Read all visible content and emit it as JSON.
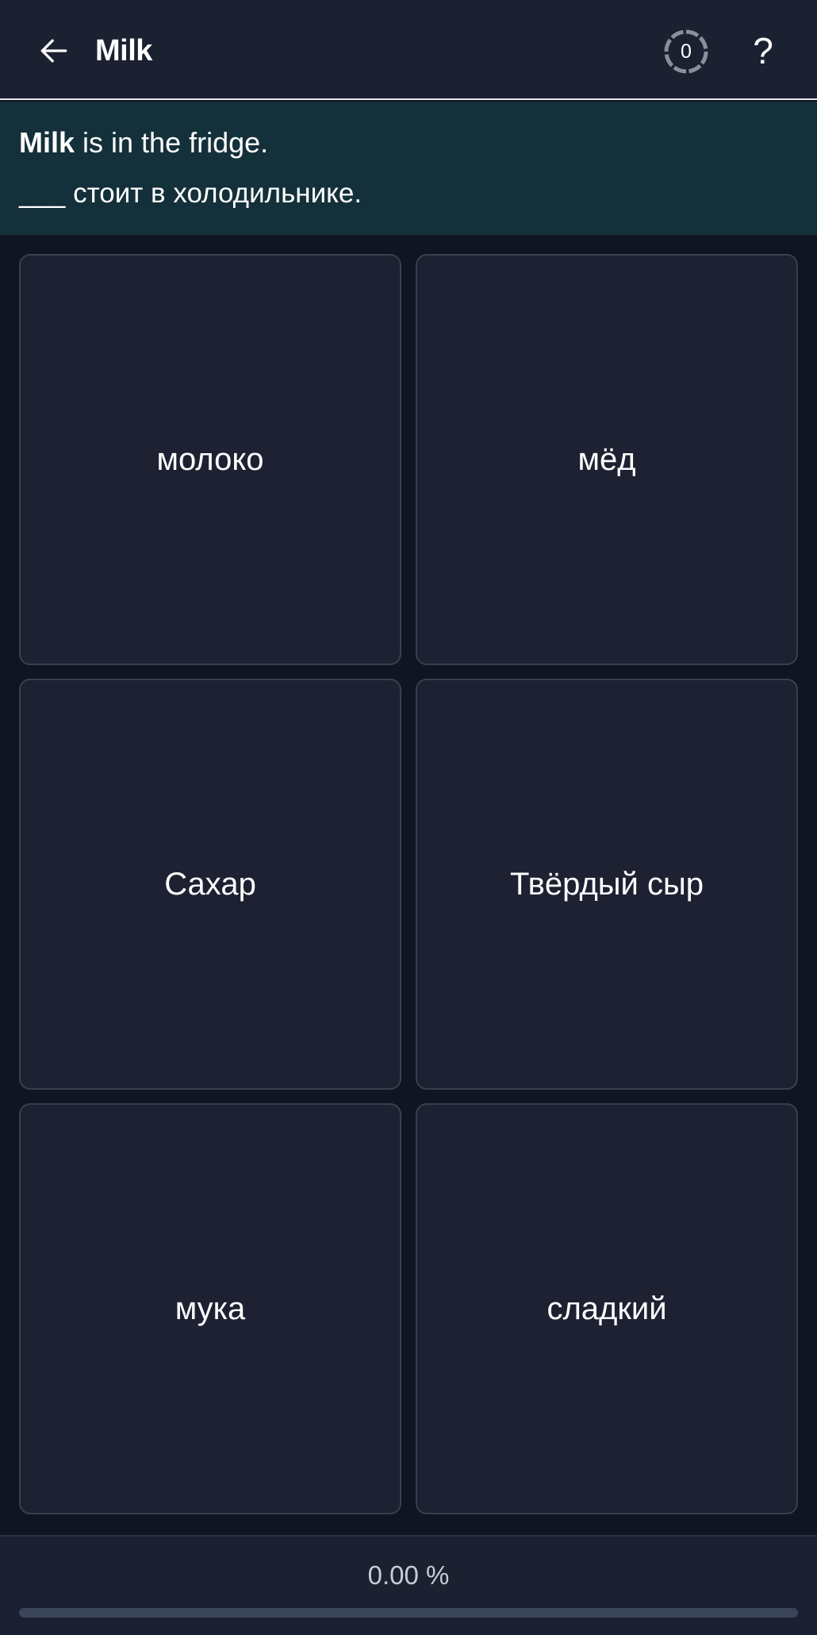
{
  "header": {
    "back_icon": "arrow-left-icon",
    "title": "Milk",
    "counter": "0",
    "help_label": "?"
  },
  "prompt": {
    "highlight": "Milk",
    "sentence_rest": " is in the fridge.",
    "blank": "___",
    "translation_rest": " стоит в холодильнике."
  },
  "options": [
    {
      "label": "молоко"
    },
    {
      "label": "мёд"
    },
    {
      "label": "Сахар"
    },
    {
      "label": "Твёрдый сыр"
    },
    {
      "label": "мука"
    },
    {
      "label": "сладкий"
    }
  ],
  "footer": {
    "progress_text": "0.00 %",
    "progress_fraction": 0.0
  },
  "colors": {
    "background": "#0f1522",
    "header": "#1c2131",
    "prompt_bg": "#14303a",
    "card_bg": "#1d2131",
    "card_border": "#3a3f4f",
    "progress_track": "#3a4559"
  }
}
